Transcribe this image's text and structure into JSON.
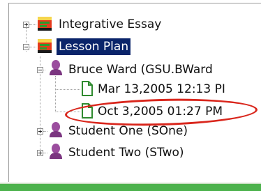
{
  "tree": {
    "nodes": [
      {
        "label": "Integrative Essay",
        "icon": "assignment-icon",
        "expanded": false
      },
      {
        "label": "Lesson Plan",
        "icon": "assignment-icon",
        "expanded": true,
        "selected": true
      },
      {
        "label": "Bruce Ward (GSU.BWard",
        "icon": "student-icon",
        "expanded": true
      },
      {
        "label": "Mar 13,2005 12:13 PI",
        "icon": "document-icon"
      },
      {
        "label": "Oct 3,2005 01:27 PM",
        "icon": "document-icon",
        "highlighted": true
      },
      {
        "label": "Student One (SOne)",
        "icon": "student-icon",
        "expanded": false
      },
      {
        "label": "Student Two (STwo)",
        "icon": "student-icon",
        "expanded": false
      }
    ]
  },
  "colors": {
    "selection": "#0a246a",
    "highlight_ring": "#d9261c",
    "status_bar": "#4cb24c"
  }
}
